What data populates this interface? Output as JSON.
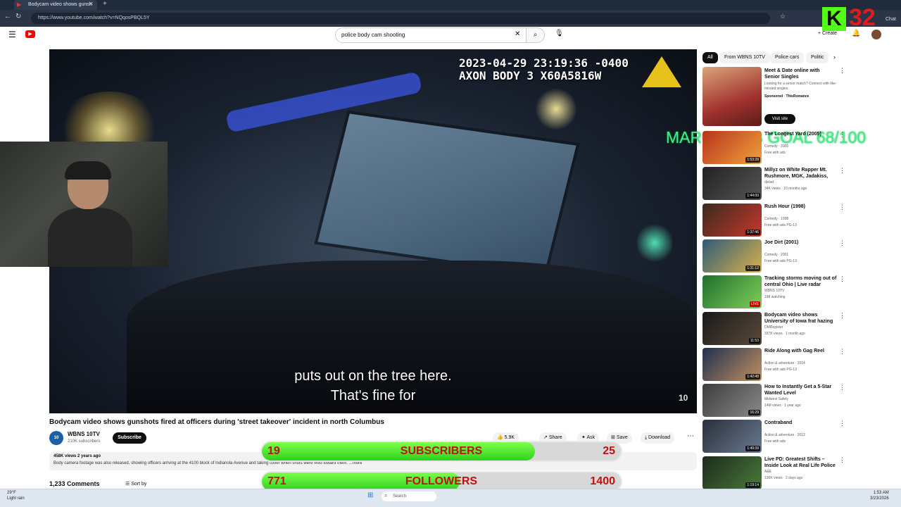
{
  "browser": {
    "tab_title": "Bodycam video shows gunsh",
    "url": "https://www.youtube.com/watch?v=NQqosPBQL5Y"
  },
  "header": {
    "search_query": "police body cam shooting",
    "create_label": "Create"
  },
  "video": {
    "osd_line1": "2023-04-29 23:19:36 -0400",
    "osd_line2": "AXON BODY 3 X60A5816W",
    "caption_line1": "puts out on the tree here.",
    "caption_line2": "That's fine for",
    "watermark": "10"
  },
  "info": {
    "title": "Bodycam video shows gunshots fired at officers during 'street takeover' incident in north Columbus",
    "channel": "WBNS 10TV",
    "subscribers": "210K subscribers",
    "subscribe": "Subscribe",
    "likes": "5.9K",
    "share": "Share",
    "ask": "Ask",
    "save": "Save",
    "download": "Download",
    "views_date": "458K views  2 years ago",
    "description": "Body camera footage was also released, showing officers arriving at the 4100 block of Indianola Avenue and taking cover when shots were fired toward them.  ...more",
    "comments": "1,233 Comments",
    "sort_by": "Sort by"
  },
  "overlay": {
    "subscribers_current": "19",
    "subscribers_label": "SUBSCRIBERS",
    "subscribers_goal": "25",
    "subscribers_progress": 0.76,
    "followers_current": "771",
    "followers_label": "FOLLOWERS",
    "followers_goal": "1400",
    "followers_progress": 0.55,
    "goal_text": "MARCH SUB GOAL 68/100",
    "kick_letter": "K",
    "kick_count": "32",
    "chat_label": "Chat"
  },
  "sidebar": {
    "chips": [
      "All",
      "From WBNS 10TV",
      "Police cars",
      "Politic"
    ],
    "ad": {
      "title": "Meet & Date online with Senior Singles",
      "desc": "Looking for a senior match? Connect with like-minded singles.",
      "sponsor": "Sponsored · ThisRomance",
      "cta": "Visit site"
    },
    "items": [
      {
        "title": "The Longest Yard (2005)",
        "channel": "Comedy · 2005",
        "meta": "Free with ads",
        "duration": "1:53:28"
      },
      {
        "title": "Millyz on White Rapper Mt. Rushmore, MGK, Jadakiss, As...",
        "channel": "djvlad",
        "meta": "34K views · 10 months ago",
        "duration": "1:44:00"
      },
      {
        "title": "Rush Hour (1998)",
        "channel": "Comedy · 1998",
        "meta": "Free with ads  PG-13",
        "duration": "1:37:46"
      },
      {
        "title": "Joe Dirt (2001)",
        "channel": "Comedy · 2001",
        "meta": "Free with ads  PG-13",
        "duration": "1:31:12"
      },
      {
        "title": "Tracking storms moving out of central Ohio | Live radar",
        "channel": "WBNS 10TV",
        "meta": "198 watching",
        "duration": "LIVE"
      },
      {
        "title": "Bodycam video shows University of Iowa frat hazing ...",
        "channel": "DMRegister",
        "meta": "337K views · 1 month ago",
        "duration": "11:53"
      },
      {
        "title": "Ride Along with Gag Reel",
        "channel": "Action & adventure · 2014",
        "meta": "Free with ads  PG-13",
        "duration": "1:42:48"
      },
      {
        "title": "How to Instantly Get a 5-Star Wanted Level",
        "channel": "Midwest Safety",
        "meta": "14M views · 1 year ago",
        "duration": "16:29"
      },
      {
        "title": "Contraband",
        "channel": "Action & adventure · 2012",
        "meta": "Free with ads",
        "duration": "1:49:39"
      },
      {
        "title": "Live PD: Greatest Shifts – Inside Look at Real Life Police Work ...",
        "channel": "A&E",
        "meta": "136K views · 2 days ago",
        "duration": "1:19:14"
      }
    ]
  },
  "taskbar": {
    "weather_temp": "29°F",
    "weather_desc": "Light rain",
    "search": "Search",
    "time": "1:53 AM",
    "date": "3/23/2026"
  },
  "colors": {
    "progress_green": "#2ed11f",
    "overlay_red": "#c01010",
    "goal_green": "#43f07a",
    "kick_green": "#53fc18"
  }
}
